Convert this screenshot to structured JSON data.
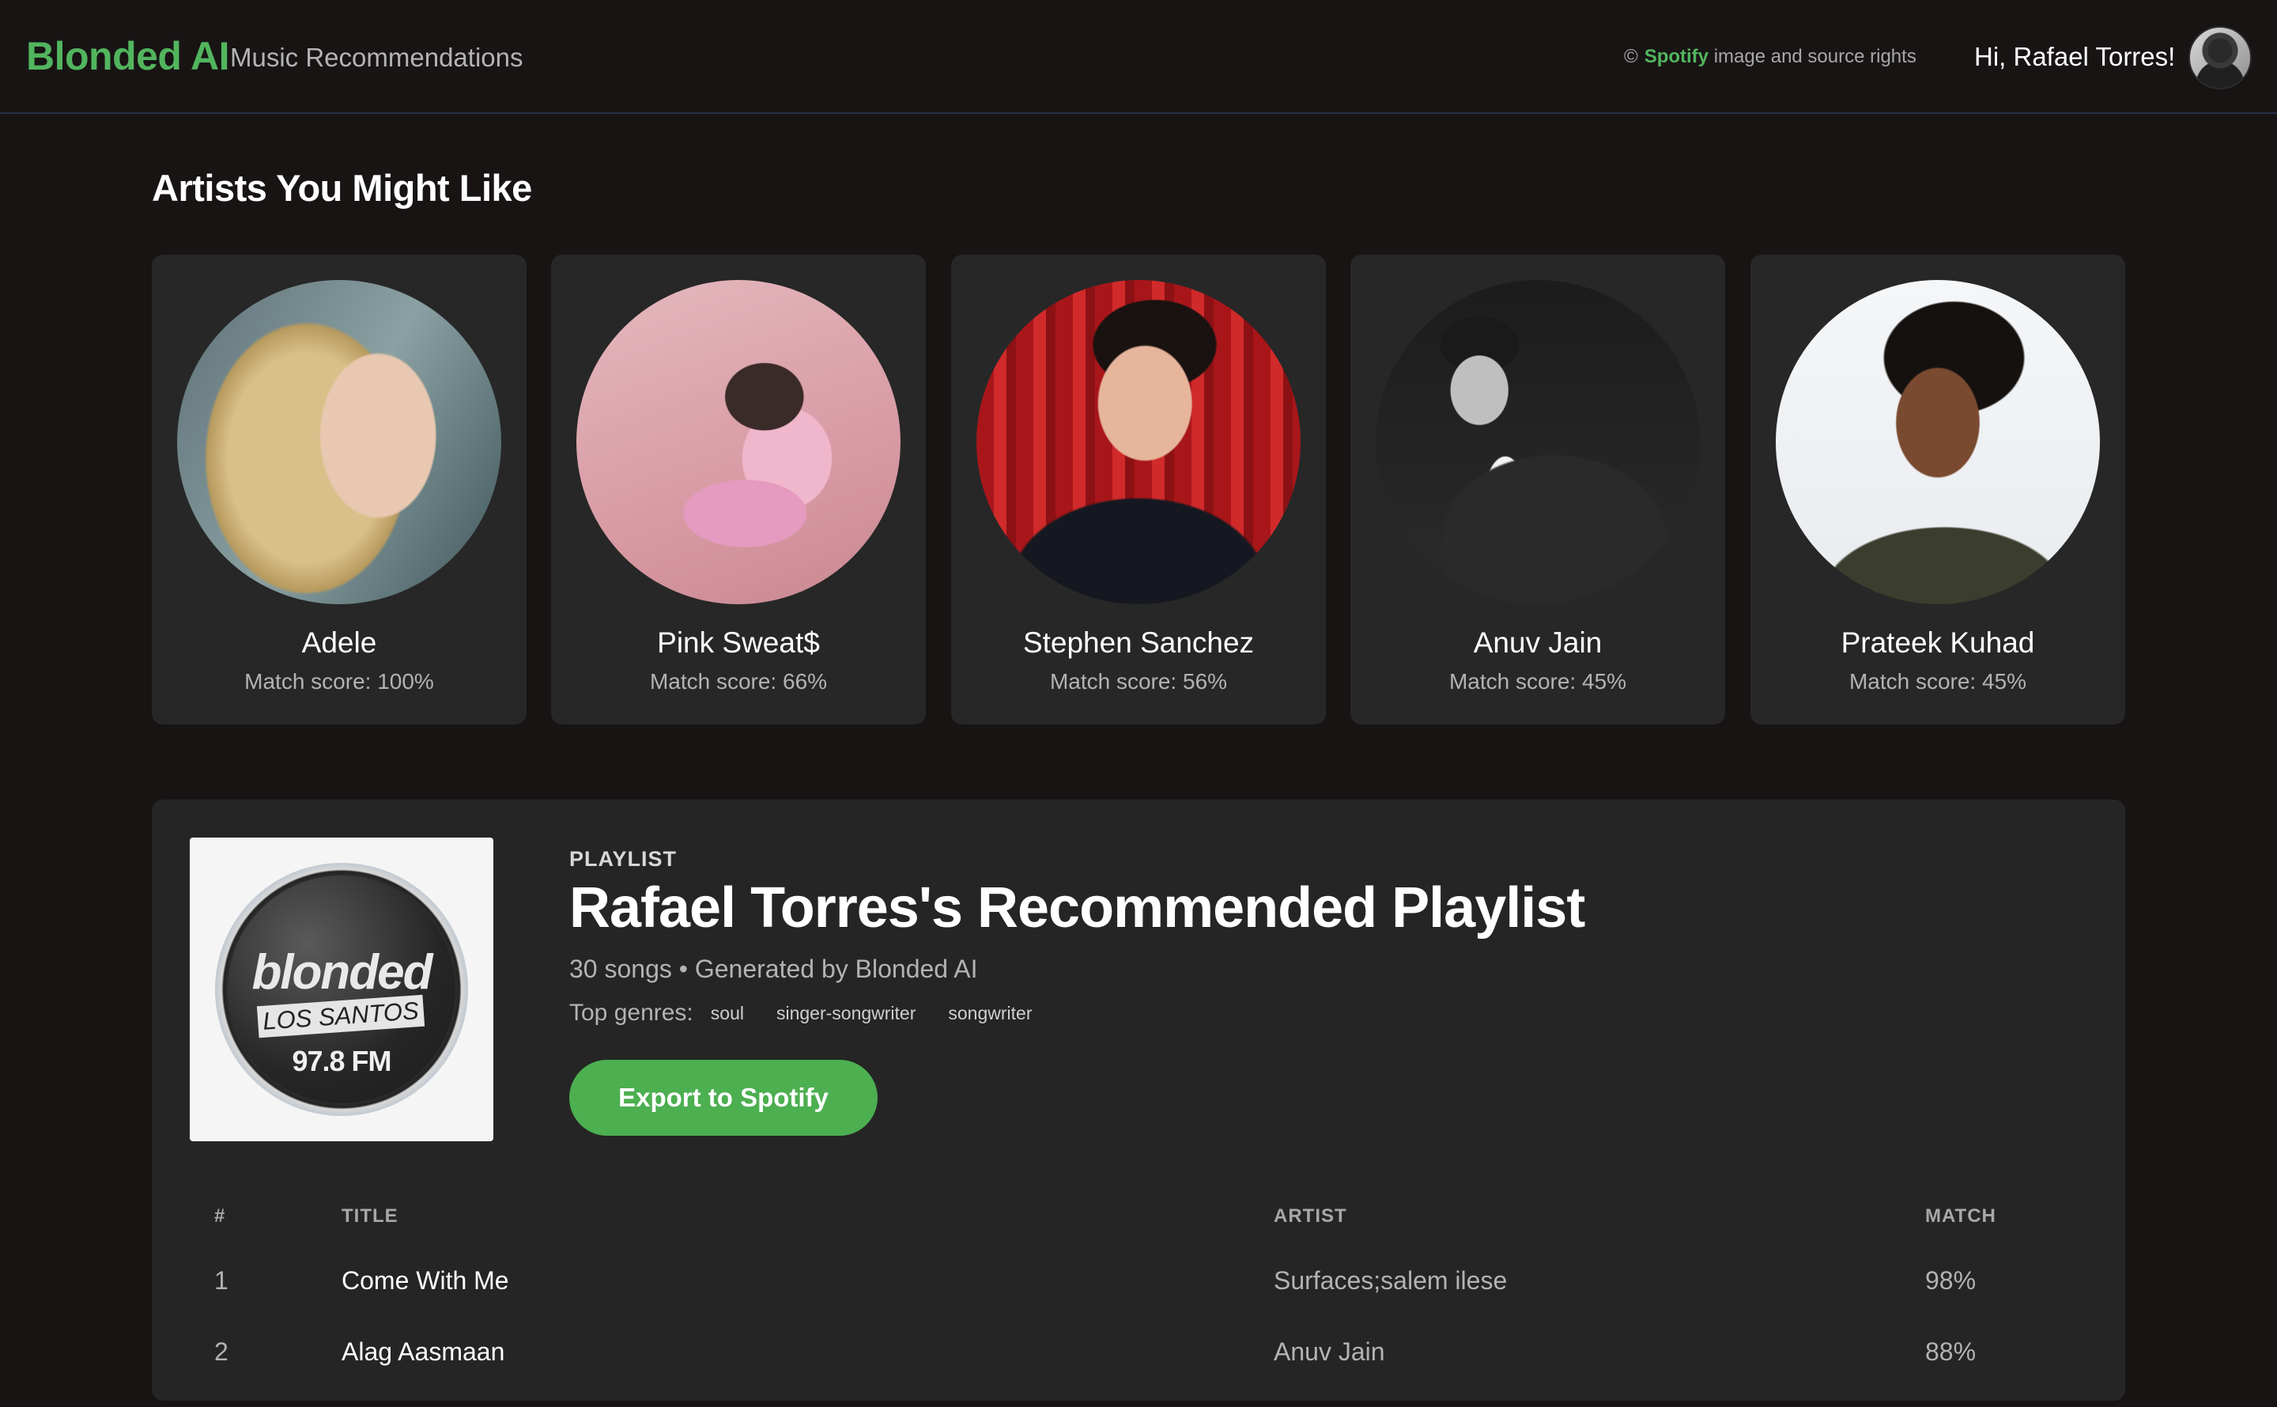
{
  "header": {
    "brand": "Blonded AI",
    "subtitle": "Music Recommendations",
    "rights_copy": "©",
    "rights_brand": "Spotify",
    "rights_text": "image and source rights",
    "greeting": "Hi, Rafael Torres!"
  },
  "artists_section": {
    "title": "Artists You Might Like",
    "artists": [
      {
        "name": "Adele",
        "score": "Match score: 100%"
      },
      {
        "name": "Pink Sweat$",
        "score": "Match score: 66%"
      },
      {
        "name": "Stephen Sanchez",
        "score": "Match score: 56%"
      },
      {
        "name": "Anuv Jain",
        "score": "Match score: 45%"
      },
      {
        "name": "Prateek Kuhad",
        "score": "Match score: 45%"
      }
    ]
  },
  "playlist": {
    "cover_text_1": "blonded",
    "cover_text_2": "LOS SANTOS",
    "cover_text_3": "97.8 FM",
    "label": "PLAYLIST",
    "title": "Rafael Torres's Recommended Playlist",
    "meta": "30 songs • Generated by Blonded AI",
    "genres_label": "Top genres:",
    "genres": [
      "soul",
      "singer-songwriter",
      "songwriter"
    ],
    "export_label": "Export to Spotify",
    "columns": {
      "num": "#",
      "title": "TITLE",
      "artist": "ARTIST",
      "match": "MATCH"
    },
    "tracks": [
      {
        "num": "1",
        "title": "Come With Me",
        "artist": "Surfaces;salem ilese",
        "match": "98%"
      },
      {
        "num": "2",
        "title": "Alag Aasmaan",
        "artist": "Anuv Jain",
        "match": "88%"
      }
    ]
  }
}
